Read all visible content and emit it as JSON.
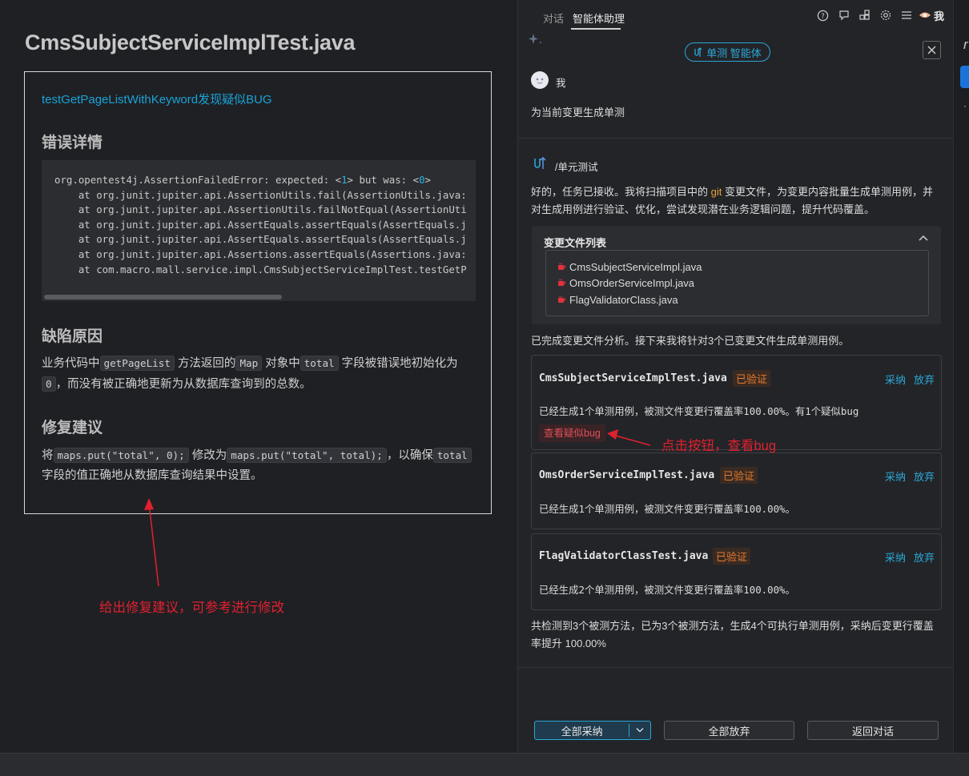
{
  "editor": {
    "file_title": "CmsSubjectServiceImplTest.java",
    "bug_title": "testGetPageListWithKeyword发现疑似BUG",
    "error_heading": "错误详情",
    "code_lines": [
      [
        "org.opentest4j.AssertionFailedError: expected: <",
        "1",
        "> but was: <",
        "0",
        ">"
      ],
      [
        "    at org.junit.jupiter.api.AssertionUtils.fail(AssertionUtils.java:"
      ],
      [
        "    at org.junit.jupiter.api.AssertionUtils.failNotEqual(AssertionUti"
      ],
      [
        "    at org.junit.jupiter.api.AssertEquals.assertEquals(AssertEquals.j"
      ],
      [
        "    at org.junit.jupiter.api.AssertEquals.assertEquals(AssertEquals.j"
      ],
      [
        "    at org.junit.jupiter.api.Assertions.assertEquals(Assertions.java:"
      ],
      [
        "    at com.macro.mall.service.impl.CmsSubjectServiceImplTest.testGetP"
      ]
    ],
    "cause_heading": "缺陷原因",
    "cause": {
      "t1": "业务代码中",
      "c1": "getPageList",
      "t2": "方法返回的",
      "c2": "Map",
      "t3": "对象中",
      "c3": "total",
      "t4": "字段被错误地初始化为",
      "c4": "0",
      "t5": "，而没有被正确地更新为从数据库查询到的总数。"
    },
    "fix_heading": "修复建议",
    "fix": {
      "t1": "将",
      "c1": "maps.put(\"total\", 0);",
      "t2": "修改为",
      "c2": "maps.put(\"total\", total);",
      "t3": "，以确保",
      "c3": "total",
      "t4": "字段的值正确地从数据库查询结果中设置。"
    }
  },
  "annotations": {
    "fix_hint": "给出修复建议，可参考进行修改",
    "bug_hint": "点击按钮，查看bug"
  },
  "panel": {
    "tabs": {
      "chat": "对话",
      "agent": "智能体助理"
    },
    "me_label": "我",
    "icons": [
      "help-icon",
      "chat-bubble-icon",
      "plugins-icon",
      "settings-icon",
      "list-icon"
    ],
    "agent_pill": "单测 智能体",
    "user_name": "我",
    "user_message": "为当前变更生成单测",
    "command_label": "/单元测试",
    "intro": {
      "t1": "好的，任务已接收。我将扫描项目中的 ",
      "git": "git",
      "t2": " 变更文件，为变更内容批量生成单测用例，并对生成用例进行验证、优化，尝试发现潜在业务逻辑问题，提升代码覆盖。"
    },
    "files_title": "变更文件列表",
    "files": [
      "CmsSubjectServiceImpl.java",
      "OmsOrderServiceImpl.java",
      "FlagValidatorClass.java"
    ],
    "analysis": "已完成变更文件分析。接下来我将针对3个已变更文件生成单测用例。",
    "tests": [
      {
        "name": "CmsSubjectServiceImplTest.java",
        "badge": "已验证",
        "adopt": "采纳",
        "drop": "放弃",
        "desc": "已经生成1个单测用例，被测文件变更行覆盖率100.00%。有1个疑似bug",
        "view_bug": "查看疑似bug"
      },
      {
        "name": "OmsOrderServiceImplTest.java",
        "badge": "已验证",
        "adopt": "采纳",
        "drop": "放弃",
        "desc": "已经生成1个单测用例，被测文件变更行覆盖率100.00%。"
      },
      {
        "name": "FlagValidatorClassTest.java",
        "badge": "已验证",
        "adopt": "采纳",
        "drop": "放弃",
        "desc": "已经生成2个单测用例，被测文件变更行覆盖率100.00%。"
      }
    ],
    "summary": "共检测到3个被测方法，已为3个被测方法，生成4个可执行单测用例，采纳后变更行覆盖率提升 100.00%",
    "buttons": {
      "adopt_all": "全部采纳",
      "drop_all": "全部放弃",
      "back": "返回对话"
    }
  },
  "strip": {
    "letter": "r",
    "dots": "·"
  },
  "colors": {
    "accent": "#2aa7d6",
    "annotation": "#e0202e",
    "badge": "#e47a2e",
    "bug": "#e0505a"
  }
}
